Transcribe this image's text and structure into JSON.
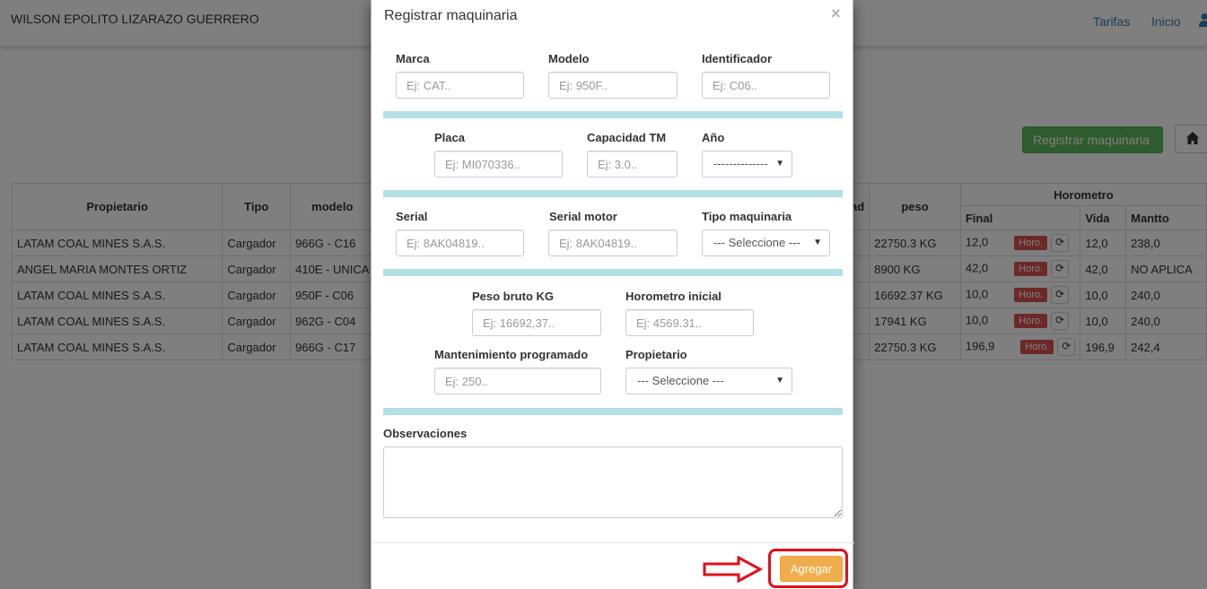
{
  "navbar": {
    "brand": "WILSON EPOLITO LIZARAZO GUERRERO",
    "links": [
      "Tarifas",
      "Inicio"
    ]
  },
  "actions": {
    "register_label": "Registrar maquinaria",
    "register_icon": "plus-icon",
    "home_icon": "home-icon"
  },
  "table": {
    "headers": {
      "propietario": "Propietario",
      "tipo": "Tipo",
      "modelo": "modelo",
      "hidden_partial": "ad",
      "peso": "peso",
      "horometro": "Horometro",
      "final": "Final",
      "vida": "Vida",
      "mantto": "Mantto"
    },
    "horo_label": "Horo.",
    "rows": [
      {
        "propietario": "LATAM COAL MINES S.A.S.",
        "tipo": "Cargador",
        "modelo": "966G - C16",
        "peso": "22750.3 KG",
        "final": "12,0",
        "vida": "12,0",
        "mantto": "238,0"
      },
      {
        "propietario": "ANGEL MARIA MONTES ORTIZ",
        "tipo": "Cargador",
        "modelo": "410E - UNICA",
        "peso": "8900 KG",
        "final": "42,0",
        "vida": "42,0",
        "mantto": "NO APLICA"
      },
      {
        "propietario": "LATAM COAL MINES S.A.S.",
        "tipo": "Cargador",
        "modelo": "950F - C06",
        "peso": "16692.37 KG",
        "final": "10,0",
        "vida": "10,0",
        "mantto": "240,0"
      },
      {
        "propietario": "LATAM COAL MINES S.A.S.",
        "tipo": "Cargador",
        "modelo": "962G - C04",
        "peso": "17941 KG",
        "final": "10,0",
        "vida": "10,0",
        "mantto": "240,0"
      },
      {
        "propietario": "LATAM COAL MINES S.A.S.",
        "tipo": "Cargador",
        "modelo": "966G - C17",
        "peso": "22750.3 KG",
        "final": "196,9",
        "vida": "196,9",
        "mantto": "242,4"
      }
    ]
  },
  "modal": {
    "title": "Registrar maquinaria",
    "close": "×",
    "fields": {
      "marca": {
        "label": "Marca",
        "placeholder": "Ej: CAT.."
      },
      "modelo": {
        "label": "Modelo",
        "placeholder": "Ej: 950F.."
      },
      "identificador": {
        "label": "Identificador",
        "placeholder": "Ej: C06.."
      },
      "placa": {
        "label": "Placa",
        "placeholder": "Ej: MI070336.."
      },
      "capacidad": {
        "label": "Capacidad TM",
        "placeholder": "Ej: 3.0.."
      },
      "anio": {
        "label": "Año",
        "value": "--------------"
      },
      "serial": {
        "label": "Serial",
        "placeholder": "Ej: 8AK04819.."
      },
      "serial_motor": {
        "label": "Serial motor",
        "placeholder": "Ej: 8AK04819.."
      },
      "tipo_maquinaria": {
        "label": "Tipo maquinaria",
        "value": "--- Seleccione ---"
      },
      "peso_bruto": {
        "label": "Peso bruto KG",
        "placeholder": "Ej: 16692,37.."
      },
      "horometro_inicial": {
        "label": "Horometro inicial",
        "placeholder": "Ej: 4569.31.."
      },
      "mantenimiento": {
        "label": "Mantenimiento programado",
        "placeholder": "Ej: 250.."
      },
      "propietario": {
        "label": "Propietario",
        "value": "--- Seleccione ---"
      },
      "observaciones": {
        "label": "Observaciones",
        "value": ""
      }
    },
    "submit_label": "Agregar"
  },
  "colors": {
    "success": "#5cb85c",
    "danger": "#d9534f",
    "warning": "#f0ad4e",
    "divider": "#b2e0e4",
    "annotation": "#e0101a"
  }
}
